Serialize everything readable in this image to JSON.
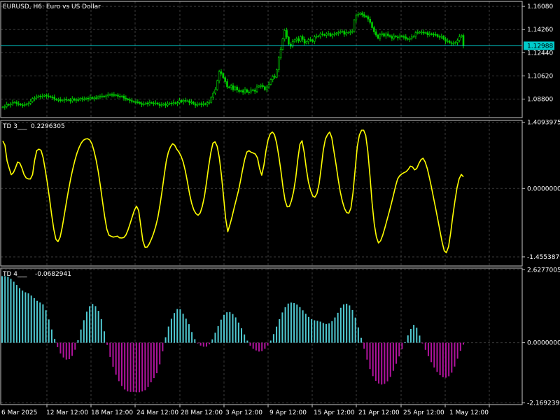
{
  "colors": {
    "background": "#000000",
    "grid": "#3a3a3a",
    "frame": "#c8c8c8",
    "text": "#ffffff",
    "candle": "#00d000",
    "bid_line": "#00cccc",
    "td3_line": "#ffff00",
    "td4_positive": "#4fc8d0",
    "td4_negative": "#b0139d"
  },
  "chart_data": [
    {
      "type": "candlestick",
      "title": "EURUSD, H6:  Euro vs US Dollar",
      "y_ticks": [
        "1.16080",
        "1.14260",
        "1.12440",
        "1.10620",
        "1.08800"
      ],
      "y_tick_values": [
        1.1608,
        1.1426,
        1.1244,
        1.1062,
        1.088
      ],
      "ylim": [
        1.0735,
        1.1647
      ],
      "current_price_label": "1.12988",
      "current_price": 1.12988,
      "close_series": [
        1.0818,
        1.0822,
        1.0838,
        1.0835,
        1.0842,
        1.0855,
        1.0856,
        1.0844,
        1.084,
        1.0835,
        1.0834,
        1.0836,
        1.0843,
        1.0848,
        1.0861,
        1.0885,
        1.0889,
        1.0896,
        1.0905,
        1.0899,
        1.0903,
        1.091,
        1.0905,
        1.0901,
        1.0896,
        1.0895,
        1.0879,
        1.0876,
        1.0876,
        1.0868,
        1.0872,
        1.0878,
        1.0873,
        1.0874,
        1.0866,
        1.0883,
        1.0872,
        1.0875,
        1.0873,
        1.0886,
        1.088,
        1.088,
        1.0887,
        1.0881,
        1.0894,
        1.0884,
        1.089,
        1.0889,
        1.09,
        1.0902,
        1.0904,
        1.0899,
        1.0906,
        1.0913,
        1.0916,
        1.0915,
        1.0909,
        1.0913,
        1.0902,
        1.0901,
        1.0904,
        1.0888,
        1.088,
        1.0877,
        1.0869,
        1.0862,
        1.086,
        1.0858,
        1.0855,
        1.0846,
        1.0838,
        1.0842,
        1.085,
        1.0842,
        1.0853,
        1.085,
        1.0847,
        1.085,
        1.0841,
        1.0831,
        1.0835,
        1.0843,
        1.0832,
        1.0843,
        1.0849,
        1.0846,
        1.0852,
        1.0846,
        1.0852,
        1.087,
        1.0858,
        1.087,
        1.0867,
        1.0867,
        1.0853,
        1.0857,
        1.0843,
        1.0832,
        1.0838,
        1.0845,
        1.0837,
        1.0844,
        1.084,
        1.0852,
        1.0855,
        1.0894,
        1.0927,
        1.0955,
        1.1024,
        1.1095,
        1.1081,
        1.1049,
        1.1018,
        1.0976,
        1.0972,
        1.0985,
        1.0954,
        1.0976,
        1.0951,
        1.094,
        1.0946,
        1.0934,
        1.0954,
        1.0936,
        1.0935,
        1.0953,
        1.0949,
        1.0942,
        1.0976,
        1.0983,
        1.0986,
        1.0978,
        1.0954,
        1.0976,
        1.0996,
        1.1034,
        1.1057,
        1.1052,
        1.1111,
        1.1204,
        1.127,
        1.1353,
        1.1419,
        1.1367,
        1.1311,
        1.1295,
        1.133,
        1.1345,
        1.1354,
        1.1335,
        1.1371,
        1.1349,
        1.1319,
        1.1331,
        1.1347,
        1.1345,
        1.1332,
        1.1369,
        1.1372,
        1.1375,
        1.1392,
        1.1386,
        1.1381,
        1.139,
        1.1395,
        1.1376,
        1.1386,
        1.1389,
        1.1397,
        1.1403,
        1.1407,
        1.1412,
        1.1389,
        1.1402,
        1.1403,
        1.1408,
        1.1411,
        1.15,
        1.1537,
        1.1545,
        1.1554,
        1.1544,
        1.1531,
        1.1527,
        1.1508,
        1.1482,
        1.1441,
        1.1408,
        1.1383,
        1.1358,
        1.1386,
        1.1394,
        1.1374,
        1.1392,
        1.1379,
        1.1372,
        1.1357,
        1.1375,
        1.1369,
        1.1361,
        1.1376,
        1.1371,
        1.1368,
        1.1355,
        1.1349,
        1.1357,
        1.1368,
        1.1373,
        1.1402,
        1.1402,
        1.1406,
        1.1406,
        1.1398,
        1.1402,
        1.1385,
        1.1393,
        1.1389,
        1.1387,
        1.1386,
        1.1371,
        1.1367,
        1.1373,
        1.1352,
        1.1334,
        1.1337,
        1.1323,
        1.1318,
        1.1318,
        1.1325,
        1.1341,
        1.137,
        1.138,
        1.1299
      ]
    },
    {
      "type": "line",
      "title": "TD 3___",
      "current_value": "0.2296305",
      "y_ticks": [
        "1.4093975",
        "0.0000000",
        "-1.4553876"
      ],
      "y_tick_values": [
        1.4093975,
        0.0,
        -1.4553876
      ],
      "ylim": [
        -1.65,
        1.45
      ],
      "values": [
        1.013,
        0.924,
        0.589,
        0.434,
        0.294,
        0.339,
        0.441,
        0.564,
        0.54,
        0.437,
        0.299,
        0.225,
        0.204,
        0.202,
        0.297,
        0.603,
        0.806,
        0.838,
        0.813,
        0.659,
        0.403,
        0.111,
        -0.207,
        -0.55,
        -0.862,
        -1.077,
        -1.131,
        -1.036,
        -0.825,
        -0.557,
        -0.28,
        -0.023,
        0.212,
        0.423,
        0.605,
        0.758,
        0.88,
        0.971,
        1.028,
        1.055,
        1.06,
        1.033,
        0.949,
        0.796,
        0.6,
        0.349,
        0.043,
        -0.28,
        -0.593,
        -0.865,
        -0.992,
        -1.015,
        -1.035,
        -1.026,
        -1.014,
        -1.05,
        -1.054,
        -1.045,
        -0.99,
        -0.881,
        -0.747,
        -0.599,
        -0.462,
        -0.376,
        -0.47,
        -0.793,
        -1.113,
        -1.25,
        -1.247,
        -1.181,
        -1.078,
        -0.96,
        -0.814,
        -0.625,
        -0.365,
        -0.065,
        0.272,
        0.578,
        0.773,
        0.887,
        0.953,
        0.921,
        0.834,
        0.773,
        0.689,
        0.563,
        0.373,
        0.139,
        -0.114,
        -0.321,
        -0.456,
        -0.533,
        -0.57,
        -0.52,
        -0.378,
        -0.164,
        0.139,
        0.472,
        0.764,
        0.967,
        0.994,
        0.897,
        0.656,
        0.288,
        -0.18,
        -0.642,
        -0.919,
        -0.769,
        -0.603,
        -0.411,
        -0.236,
        -0.051,
        0.166,
        0.404,
        0.627,
        0.776,
        0.805,
        0.772,
        0.755,
        0.733,
        0.649,
        0.422,
        0.285,
        0.494,
        0.809,
        1.039,
        1.166,
        1.203,
        1.148,
        0.966,
        0.697,
        0.388,
        0.024,
        -0.256,
        -0.391,
        -0.383,
        -0.258,
        -0.066,
        0.227,
        0.624,
        0.944,
        1.016,
        0.766,
        0.423,
        0.14,
        -0.041,
        -0.157,
        -0.186,
        -0.108,
        0.096,
        0.435,
        0.822,
        1.055,
        1.146,
        1.203,
        1.08,
        0.795,
        0.508,
        0.2,
        -0.071,
        -0.278,
        -0.426,
        -0.512,
        -0.526,
        -0.417,
        -0.089,
        0.407,
        0.893,
        1.137,
        1.242,
        1.241,
        1.128,
        0.789,
        0.257,
        -0.312,
        -0.75,
        -1.033,
        -1.159,
        -1.113,
        -0.991,
        -0.839,
        -0.676,
        -0.506,
        -0.333,
        -0.151,
        0.044,
        0.202,
        0.273,
        0.311,
        0.337,
        0.357,
        0.406,
        0.476,
        0.46,
        0.397,
        0.426,
        0.529,
        0.614,
        0.644,
        0.565,
        0.42,
        0.227,
        0.016,
        -0.21,
        -0.44,
        -0.673,
        -0.91,
        -1.147,
        -1.328,
        -1.365,
        -1.237,
        -0.948,
        -0.594,
        -0.267,
        0.015,
        0.207,
        0.299,
        0.249
      ]
    },
    {
      "type": "bar",
      "title": "TD 4___",
      "current_value": "-0.0682941",
      "y_ticks": [
        "2.6277005",
        "0.0000000",
        "-2.1692399"
      ],
      "y_tick_values": [
        2.6277005,
        0.0,
        -2.1692399
      ],
      "ylim": [
        -2.23,
        2.69
      ],
      "values": [
        2.4,
        2.4,
        2.377,
        2.302,
        2.199,
        2.082,
        1.969,
        1.88,
        1.818,
        1.779,
        1.7,
        1.607,
        1.511,
        1.45,
        1.384,
        1.17,
        0.84,
        0.478,
        0.138,
        -0.159,
        -0.388,
        -0.532,
        -0.607,
        -0.589,
        -0.474,
        -0.253,
        0.093,
        0.476,
        0.813,
        1.12,
        1.317,
        1.398,
        1.319,
        1.149,
        0.852,
        0.412,
        -0.078,
        -0.512,
        -0.865,
        -1.154,
        -1.384,
        -1.558,
        -1.686,
        -1.755,
        -1.771,
        -1.771,
        -1.786,
        -1.784,
        -1.757,
        -1.711,
        -1.595,
        -1.426,
        -1.274,
        -1.097,
        -0.779,
        -0.309,
        0.194,
        0.583,
        0.864,
        1.07,
        1.217,
        1.21,
        1.046,
        0.867,
        0.669,
        0.386,
        0.128,
        -0.016,
        -0.104,
        -0.143,
        -0.139,
        -0.056,
        0.12,
        0.36,
        0.6,
        0.831,
        1.003,
        1.098,
        1.107,
        1.035,
        0.913,
        0.727,
        0.521,
        0.299,
        0.078,
        -0.106,
        -0.217,
        -0.278,
        -0.318,
        -0.3,
        -0.218,
        -0.099,
        0.079,
        0.312,
        0.58,
        0.851,
        1.091,
        1.281,
        1.411,
        1.447,
        1.431,
        1.375,
        1.284,
        1.169,
        1.044,
        0.929,
        0.849,
        0.81,
        0.79,
        0.76,
        0.712,
        0.676,
        0.696,
        0.779,
        0.91,
        1.079,
        1.259,
        1.383,
        1.406,
        1.344,
        1.179,
        0.907,
        0.553,
        0.175,
        -0.216,
        -0.608,
        -0.949,
        -1.204,
        -1.373,
        -1.47,
        -1.507,
        -1.482,
        -1.392,
        -1.233,
        -1.012,
        -0.758,
        -0.493,
        -0.231,
        0.02,
        0.264,
        0.497,
        0.644,
        0.542,
        0.258,
        -0.017,
        -0.257,
        -0.484,
        -0.7,
        -0.893,
        -1.052,
        -1.171,
        -1.244,
        -1.259,
        -1.208,
        -1.079,
        -0.86,
        -0.576,
        -0.292,
        -0.068
      ]
    }
  ],
  "x_axis": {
    "labels": [
      "6 Mar 2025",
      "12 Mar 12:00",
      "18 Mar 12:00",
      "24 Mar 12:00",
      "28 Mar 12:00",
      "3 Apr 12:00",
      "9 Apr 12:00",
      "15 Apr 12:00",
      "21 Apr 12:00",
      "25 Apr 12:00",
      "1 May 12:00"
    ]
  }
}
